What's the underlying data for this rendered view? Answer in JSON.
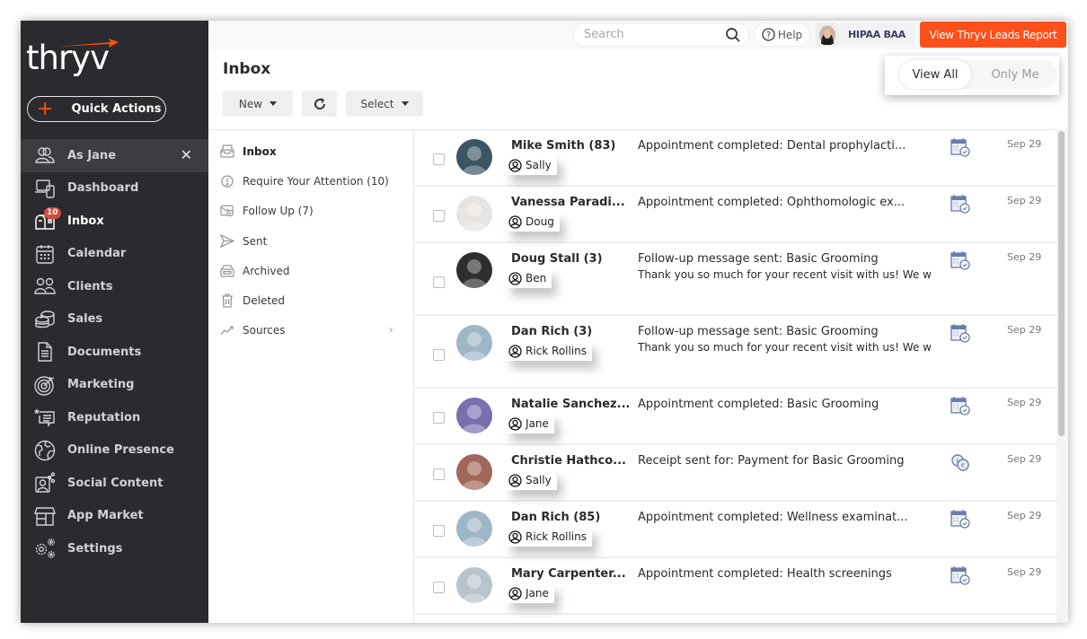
{
  "brand": {
    "logo_text": "thryv",
    "accent_color": "#ff5000"
  },
  "sidebar": {
    "quick_actions_label": "Quick Actions",
    "items": [
      {
        "label": "As Jane",
        "icon": "users-icon",
        "closable": true
      },
      {
        "label": "Dashboard",
        "icon": "devices-icon"
      },
      {
        "label": "Inbox",
        "icon": "mailbox-icon",
        "badge": "10",
        "active": true
      },
      {
        "label": "Calendar",
        "icon": "calendar-icon"
      },
      {
        "label": "Clients",
        "icon": "clients-icon"
      },
      {
        "label": "Sales",
        "icon": "coins-icon"
      },
      {
        "label": "Documents",
        "icon": "document-icon"
      },
      {
        "label": "Marketing",
        "icon": "target-icon"
      },
      {
        "label": "Reputation",
        "icon": "review-icon"
      },
      {
        "label": "Online Presence",
        "icon": "globe-icon"
      },
      {
        "label": "Social Content",
        "icon": "social-icon"
      },
      {
        "label": "App Market",
        "icon": "store-icon"
      },
      {
        "label": "Settings",
        "icon": "gears-icon"
      }
    ]
  },
  "topbar": {
    "search_placeholder": "Search",
    "help_label": "Help",
    "hipaa_label": "HIPAA BAA",
    "leads_button_label": "View Thryv Leads Report"
  },
  "header": {
    "title": "Inbox",
    "new_label": "New",
    "select_label": "Select",
    "view_all_label": "View All",
    "only_me_label": "Only Me"
  },
  "folders": [
    {
      "label": "Inbox",
      "icon": "inbox-tray-icon",
      "active": true
    },
    {
      "label": "Require Your Attention (10)",
      "icon": "alert-circle-icon"
    },
    {
      "label": "Follow Up (7)",
      "icon": "follow-up-icon"
    },
    {
      "label": "Sent",
      "icon": "send-icon"
    },
    {
      "label": "Archived",
      "icon": "archive-icon"
    },
    {
      "label": "Deleted",
      "icon": "trash-icon"
    },
    {
      "label": "Sources",
      "icon": "trend-icon",
      "has_submenu": true
    }
  ],
  "messages": [
    {
      "name": "Mike Smith (83)",
      "owner": "Sally",
      "subject": "Appointment completed: Dental prophylacti...",
      "preview": "",
      "type": "appointment",
      "date": "Sep 29",
      "avatar_color": "#3c5563"
    },
    {
      "name": "Vanessa Paradi...",
      "owner": "Doug",
      "subject": "Appointment completed: Ophthomologic ex...",
      "preview": "",
      "type": "appointment",
      "date": "Sep 29",
      "avatar_color": "#e8e4e2"
    },
    {
      "name": "Doug Stall (3)",
      "owner": "Ben",
      "subject": "Follow-up message sent: Basic Grooming",
      "preview": "Thank you so much for your recent visit with us! We w",
      "type": "appointment",
      "date": "Sep 29",
      "avatar_color": "#2e2e2e"
    },
    {
      "name": "Dan Rich (3)",
      "owner": "Rick Rollins",
      "subject": "Follow-up message sent: Basic Grooming",
      "preview": "Thank you so much for your recent visit with us! We w",
      "type": "appointment",
      "date": "Sep 29",
      "avatar_color": "#9fb6c7"
    },
    {
      "name": "Natalie Sanchez...",
      "owner": "Jane",
      "subject": "Appointment completed: Basic Grooming",
      "preview": "",
      "type": "appointment",
      "date": "Sep 29",
      "avatar_color": "#7b6fb0"
    },
    {
      "name": "Christie Hathco...",
      "owner": "Sally",
      "subject": "Receipt sent for: Payment for Basic Grooming",
      "preview": "",
      "type": "payment",
      "date": "Sep 29",
      "avatar_color": "#a1675a"
    },
    {
      "name": "Dan Rich (85)",
      "owner": "Rick Rollins",
      "subject": "Appointment completed: Wellness examinat...",
      "preview": "",
      "type": "appointment",
      "date": "Sep 29",
      "avatar_color": "#9fb6c7"
    },
    {
      "name": "Mary Carpenter...",
      "owner": "Jane",
      "subject": "Appointment completed: Health screenings",
      "preview": "",
      "type": "appointment",
      "date": "Sep 29",
      "avatar_color": "#b8c4cc"
    }
  ]
}
